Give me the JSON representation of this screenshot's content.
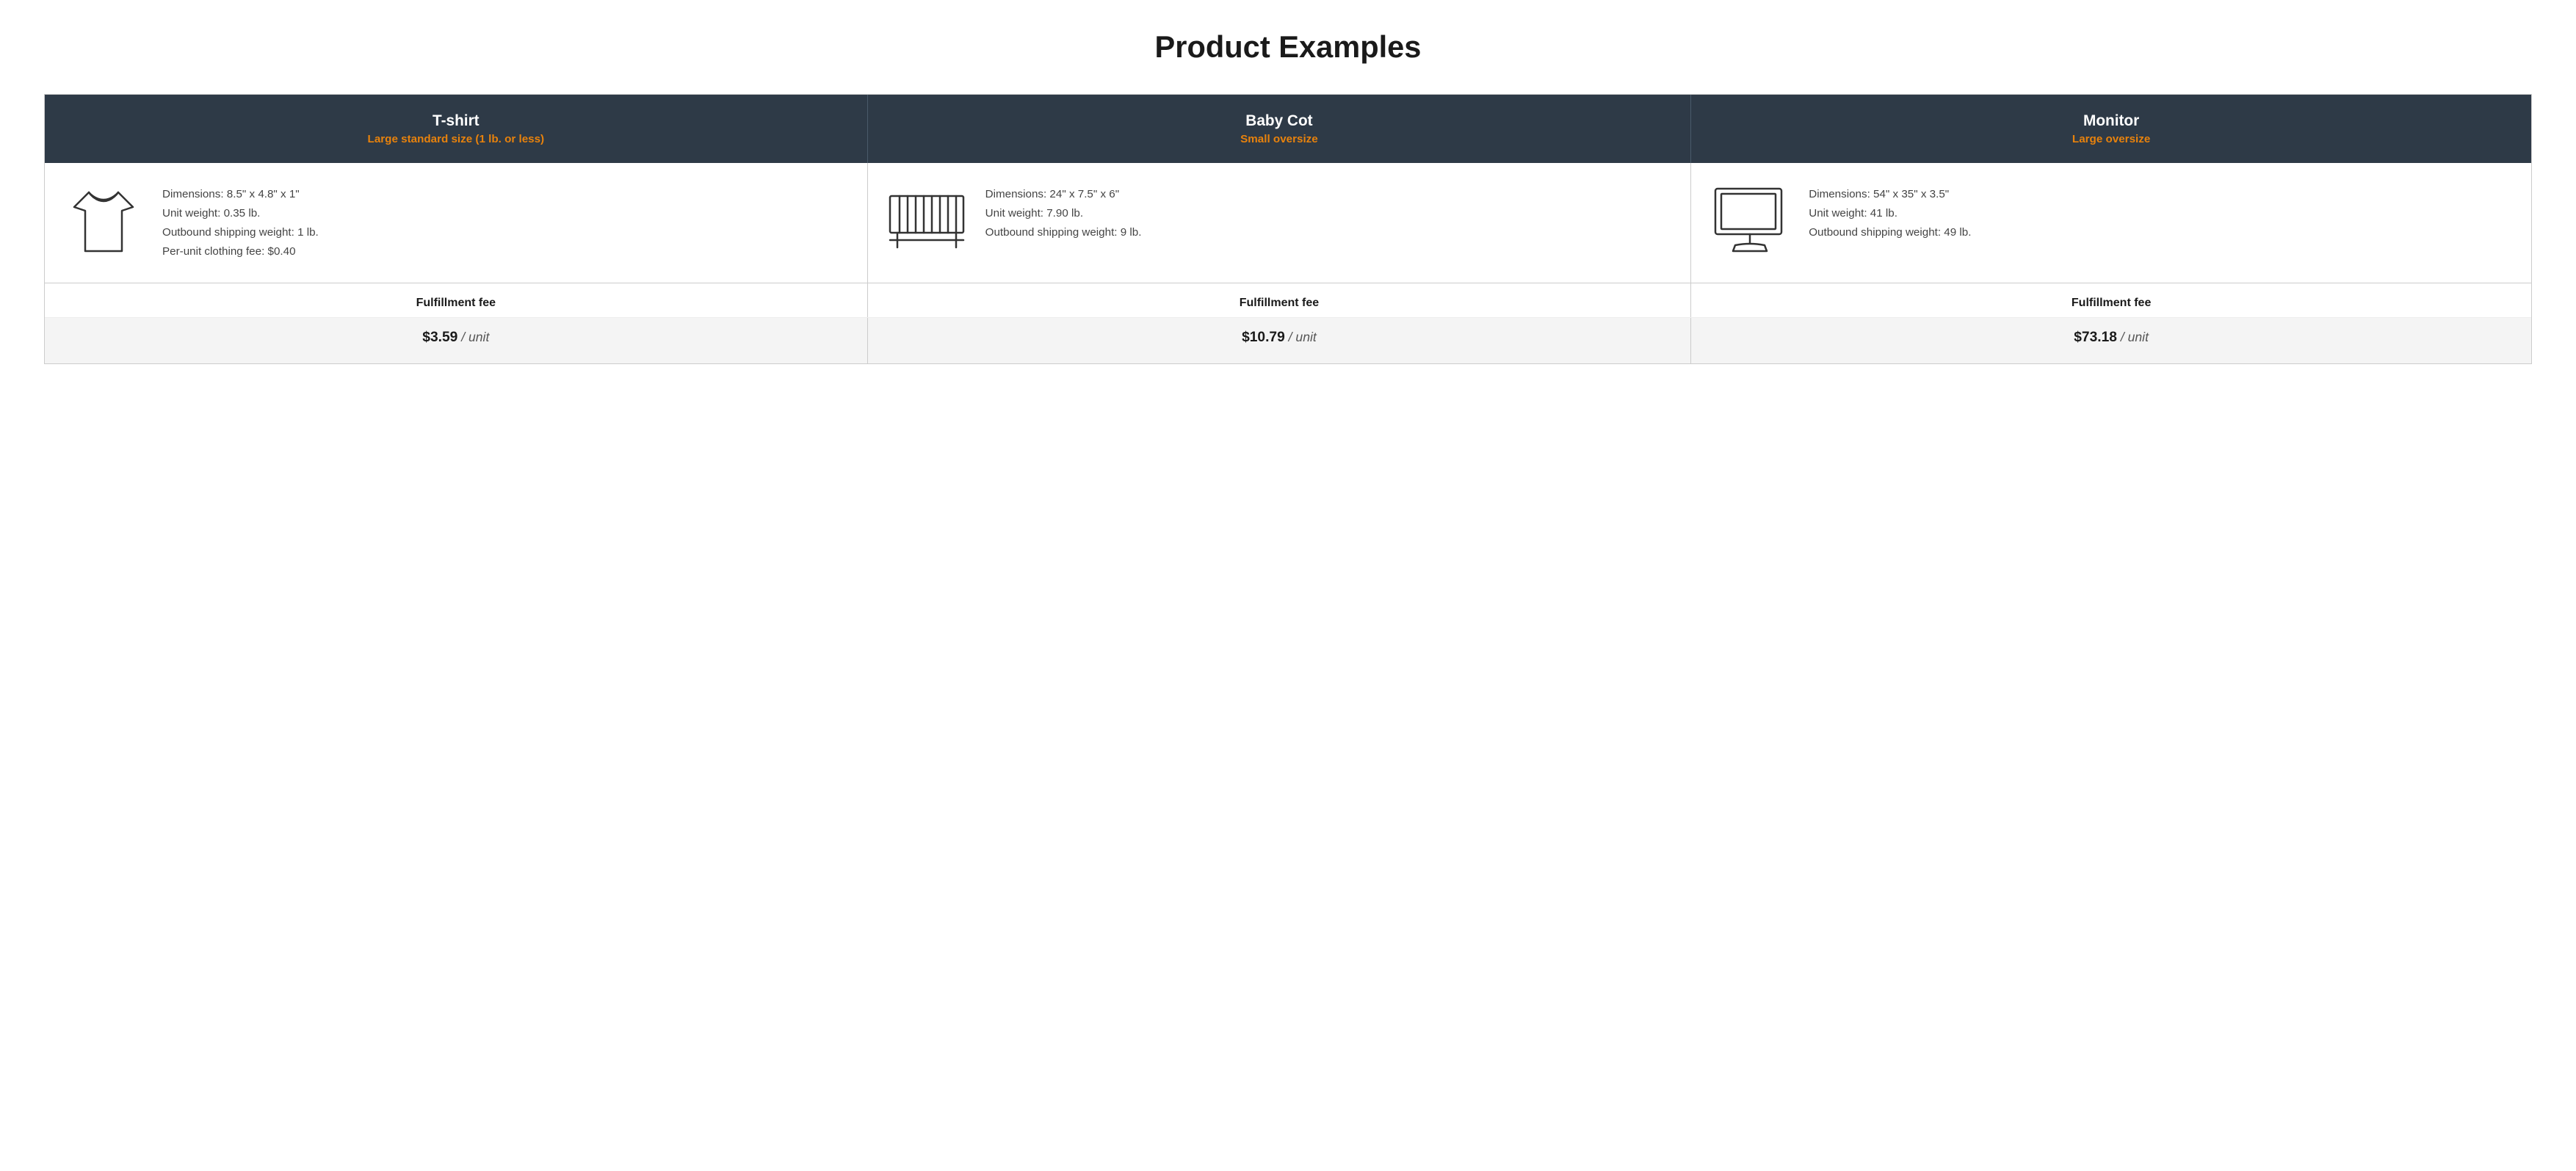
{
  "page": {
    "title": "Product Examples"
  },
  "columns": [
    {
      "product_name": "T-shirt",
      "size_label": "Large standard size (1 lb. or less)",
      "icon_type": "tshirt",
      "dimensions": "Dimensions: 8.5\" x 4.8\" x 1\"",
      "unit_weight": "Unit weight: 0.35 lb.",
      "outbound_shipping": "Outbound shipping weight: 1 lb.",
      "extra_fee": "Per-unit clothing fee: $0.40",
      "fulfillment_fee_label": "Fulfillment fee",
      "fee_amount": "$3.59",
      "fee_unit": "/ unit"
    },
    {
      "product_name": "Baby Cot",
      "size_label": "Small oversize",
      "icon_type": "cot",
      "dimensions": "Dimensions: 24\" x 7.5\" x 6\"",
      "unit_weight": "Unit weight: 7.90 lb.",
      "outbound_shipping": "Outbound shipping weight: 9 lb.",
      "extra_fee": "",
      "fulfillment_fee_label": "Fulfillment fee",
      "fee_amount": "$10.79",
      "fee_unit": "/ unit"
    },
    {
      "product_name": "Monitor",
      "size_label": "Large oversize",
      "icon_type": "monitor",
      "dimensions": "Dimensions: 54\" x 35\" x 3.5\"",
      "unit_weight": "Unit weight: 41 lb.",
      "outbound_shipping": "Outbound shipping weight: 49 lb.",
      "extra_fee": "",
      "fulfillment_fee_label": "Fulfillment fee",
      "fee_amount": "$73.18",
      "fee_unit": "/ unit"
    }
  ]
}
